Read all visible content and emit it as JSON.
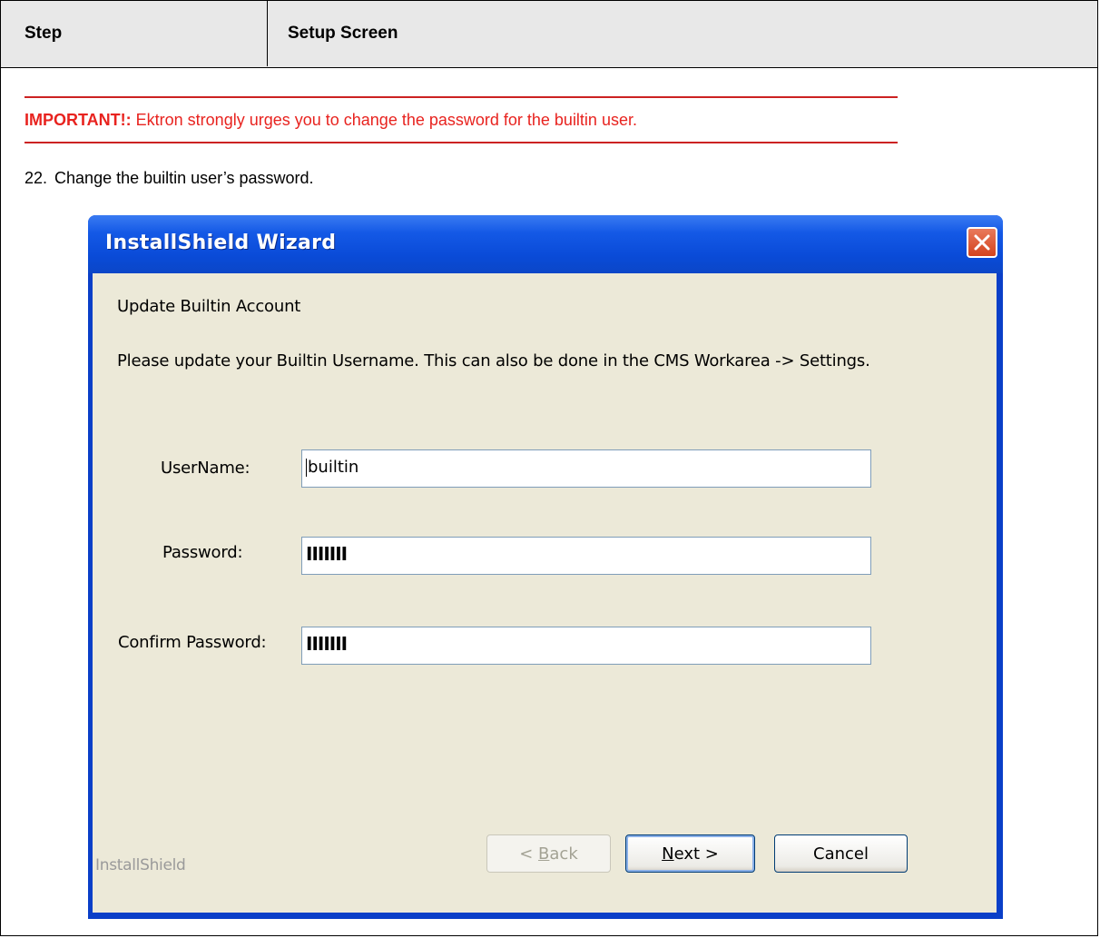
{
  "table": {
    "header_step": "Step",
    "header_setup": "Setup Screen"
  },
  "notice": {
    "label": "IMPORTANT!:",
    "text": " Ektron strongly urges you to change the password for the builtin user."
  },
  "step": {
    "number": "22.",
    "text": "Change the builtin user’s password."
  },
  "dialog": {
    "title": "InstallShield Wizard",
    "heading": "Update Builtin Account",
    "description": "Please update your Builtin Username. This can also be done in the CMS Workarea -> Settings.",
    "fields": {
      "username_label": "UserName:",
      "username_value": "builtin",
      "password_label": "Password:",
      "password_value": "IIIIIII",
      "confirm_label": "Confirm Password:",
      "confirm_value": "IIIIIII"
    },
    "brand": "InstallShield",
    "buttons": {
      "back_mnemonic": "B",
      "back_rest": "ack",
      "back_prefix": "< ",
      "next_mnemonic": "N",
      "next_rest": "ext",
      "next_suffix": " >",
      "cancel": "Cancel"
    },
    "colors": {
      "titlebar": "#0a4bd8",
      "client": "#ece9d8",
      "close": "#d3431d",
      "important": "#e8231f"
    },
    "icons": {
      "close": "close-icon"
    }
  }
}
